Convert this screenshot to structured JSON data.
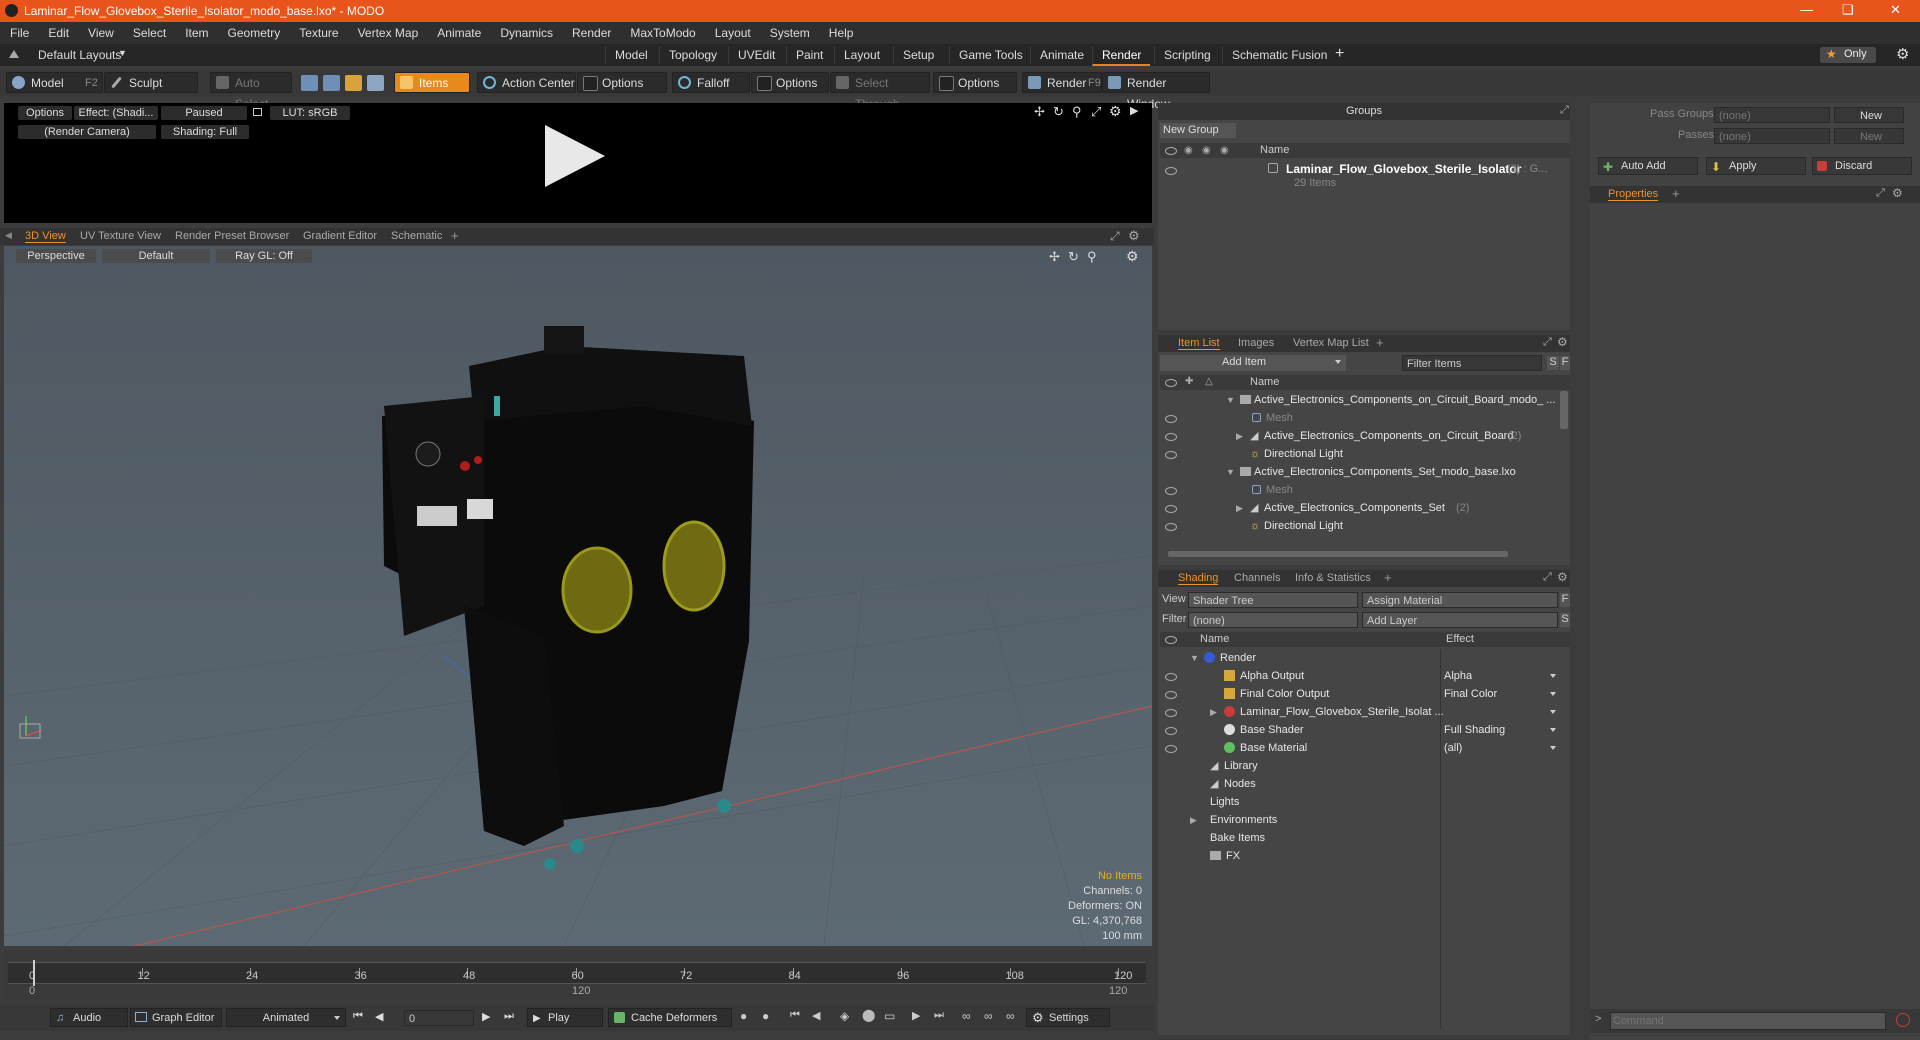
{
  "window": {
    "title": "Laminar_Flow_Glovebox_Sterile_Isolator_modo_base.lxo* - MODO"
  },
  "menu": [
    "File",
    "Edit",
    "View",
    "Select",
    "Item",
    "Geometry",
    "Texture",
    "Vertex Map",
    "Animate",
    "Dynamics",
    "Render",
    "MaxToModo",
    "Layout",
    "System",
    "Help"
  ],
  "layout": {
    "preset": "Default Layouts",
    "tabs": [
      "Model",
      "Topology",
      "UVEdit",
      "Paint",
      "Layout",
      "Setup",
      "Game Tools",
      "Animate",
      "Render",
      "Scripting",
      "Schematic Fusion"
    ],
    "active_tab": "Render",
    "only_label": "Only"
  },
  "toolbar": {
    "model": "Model",
    "model_key": "F2",
    "sculpt": "Sculpt",
    "auto_select": "Auto Select",
    "items": "Items",
    "action_center": "Action Center",
    "options1": "Options",
    "falloff": "Falloff",
    "options2": "Options",
    "select_through": "Select Through",
    "options3": "Options",
    "render": "Render",
    "render_key": "F9",
    "render_window": "Render Window"
  },
  "preview": {
    "options": "Options",
    "effect": "Effect: (Shadi...",
    "paused": "Paused",
    "lut": "LUT: sRGB",
    "camera": "(Render Camera)",
    "shading": "Shading: Full"
  },
  "viewport": {
    "tabs": [
      "3D View",
      "UV Texture View",
      "Render Preset Browser",
      "Gradient Editor",
      "Schematic"
    ],
    "perspective": "Perspective",
    "default": "Default",
    "raygl": "Ray GL: Off",
    "stats": {
      "no_items": "No Items",
      "channels": "Channels: 0",
      "deformers": "Deformers: ON",
      "gl": "GL: 4,370,768",
      "scale": "100 mm"
    }
  },
  "timeline": {
    "ticks": [
      "0",
      "12",
      "24",
      "36",
      "48",
      "60",
      "72",
      "84",
      "96",
      "108",
      "120"
    ],
    "lower_ticks": [
      "0",
      "120",
      "120"
    ]
  },
  "bottombar": {
    "audio": "Audio",
    "graph_editor": "Graph Editor",
    "animated": "Animated",
    "frame": "0",
    "play": "Play",
    "cache_deformers": "Cache Deformers",
    "settings": "Settings"
  },
  "groups": {
    "title": "Groups",
    "new_group": "New Group",
    "col_name": "Name",
    "item_name": "Laminar_Flow_Glovebox_Sterile_Isolator",
    "item_count": "(3) : G...",
    "item_sub": "29 Items"
  },
  "item_list": {
    "tabs": [
      "Item List",
      "Images",
      "Vertex Map List"
    ],
    "add_item": "Add Item",
    "filter": "Filter Items",
    "col_name": "Name",
    "rows": [
      {
        "label": "Active_Electronics_Components_on_Circuit_Board_modo_ ...",
        "suffix": ""
      },
      {
        "label": "Mesh",
        "suffix": ""
      },
      {
        "label": "Active_Electronics_Components_on_Circuit_Board",
        "suffix": "(2)"
      },
      {
        "label": "Directional Light",
        "suffix": ""
      },
      {
        "label": "Active_Electronics_Components_Set_modo_base.lxo",
        "suffix": ""
      },
      {
        "label": "Mesh",
        "suffix": ""
      },
      {
        "label": "Active_Electronics_Components_Set",
        "suffix": "(2)"
      },
      {
        "label": "Directional Light",
        "suffix": ""
      }
    ]
  },
  "shading": {
    "tabs": [
      "Shading",
      "Channels",
      "Info & Statistics"
    ],
    "view_label": "View",
    "view_value": "Shader Tree",
    "assign": "Assign Material",
    "filter_label": "Filter",
    "filter_value": "(none)",
    "add_layer": "Add Layer",
    "col_name": "Name",
    "col_effect": "Effect",
    "rows": [
      {
        "name": "Render",
        "effect": ""
      },
      {
        "name": "Alpha Output",
        "effect": "Alpha"
      },
      {
        "name": "Final Color Output",
        "effect": "Final Color"
      },
      {
        "name": "Laminar_Flow_Glovebox_Sterile_Isolat ...",
        "effect": ""
      },
      {
        "name": "Base Shader",
        "effect": "Full Shading"
      },
      {
        "name": "Base Material",
        "effect": "(all)"
      },
      {
        "name": "Library",
        "effect": ""
      },
      {
        "name": "Nodes",
        "effect": ""
      },
      {
        "name": "Lights",
        "effect": ""
      },
      {
        "name": "Environments",
        "effect": ""
      },
      {
        "name": "Bake Items",
        "effect": ""
      },
      {
        "name": "FX",
        "effect": ""
      }
    ]
  },
  "passes": {
    "pass_groups": "Pass Groups",
    "passes": "Passes",
    "none": "(none)",
    "new": "New",
    "auto_add": "Auto Add",
    "apply": "Apply",
    "discard": "Discard",
    "properties": "Properties"
  },
  "command": {
    "placeholder": "Command"
  }
}
